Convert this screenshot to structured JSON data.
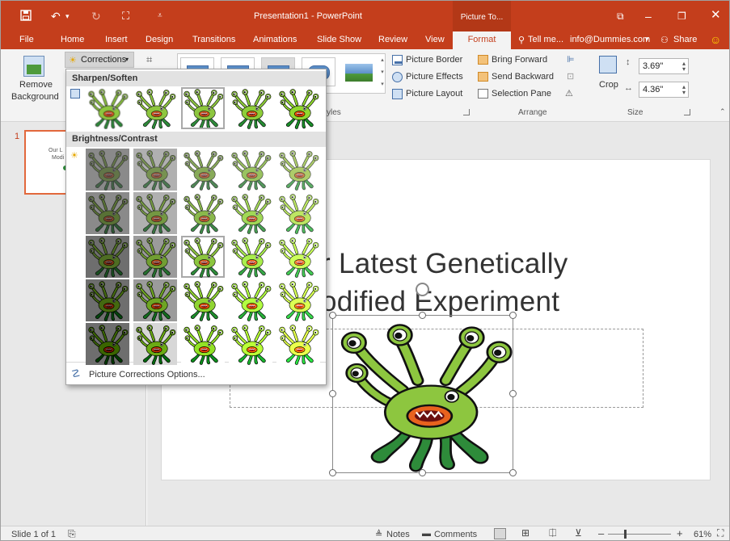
{
  "titlebar": {
    "title": "Presentation1 - PowerPoint",
    "context_tools": "Picture To...",
    "icons": [
      "save-icon",
      "undo-icon",
      "redo-icon",
      "start-from-beginning-icon",
      "customize-qat-icon",
      "ribbon-display-icon",
      "minimize-icon",
      "restore-icon",
      "close-icon"
    ]
  },
  "tabs": [
    {
      "label": "File"
    },
    {
      "label": "Home"
    },
    {
      "label": "Insert"
    },
    {
      "label": "Design"
    },
    {
      "label": "Transitions"
    },
    {
      "label": "Animations"
    },
    {
      "label": "Slide Show"
    },
    {
      "label": "Review"
    },
    {
      "label": "View"
    },
    {
      "label": "Format"
    }
  ],
  "tell_me": "Tell me...",
  "account": "info@Dummies.com",
  "share": "Share",
  "ribbon": {
    "remove_bg_line1": "Remove",
    "remove_bg_line2": "Background",
    "corrections": "Corrections",
    "picture_border": "Picture Border",
    "picture_effects": "Picture Effects",
    "picture_layout": "Picture Layout",
    "styles_label": "yles",
    "bring_forward": "Bring Forward",
    "send_backward": "Send Backward",
    "selection_pane": "Selection Pane",
    "arrange_label": "Arrange",
    "crop": "Crop",
    "height": "3.69\"",
    "width": "4.36\"",
    "size_label": "Size"
  },
  "dropdown": {
    "section1": "Sharpen/Soften",
    "section2": "Brightness/Contrast",
    "options_link": "Picture Corrections Options..."
  },
  "slide_panel": {
    "number": "1",
    "thumb_text_1": "Our L",
    "thumb_text_2": "Modi"
  },
  "slide": {
    "title_line1": "r Latest Genetically",
    "title_line2": "odified Experiment"
  },
  "status": {
    "slide_info": "Slide 1 of 1",
    "notes": "Notes",
    "comments": "Comments",
    "zoom": "61%"
  },
  "colors": {
    "accent": "#c43e1c",
    "monster_green": "#8dc63f",
    "monster_dark_green": "#2e8b3a"
  }
}
